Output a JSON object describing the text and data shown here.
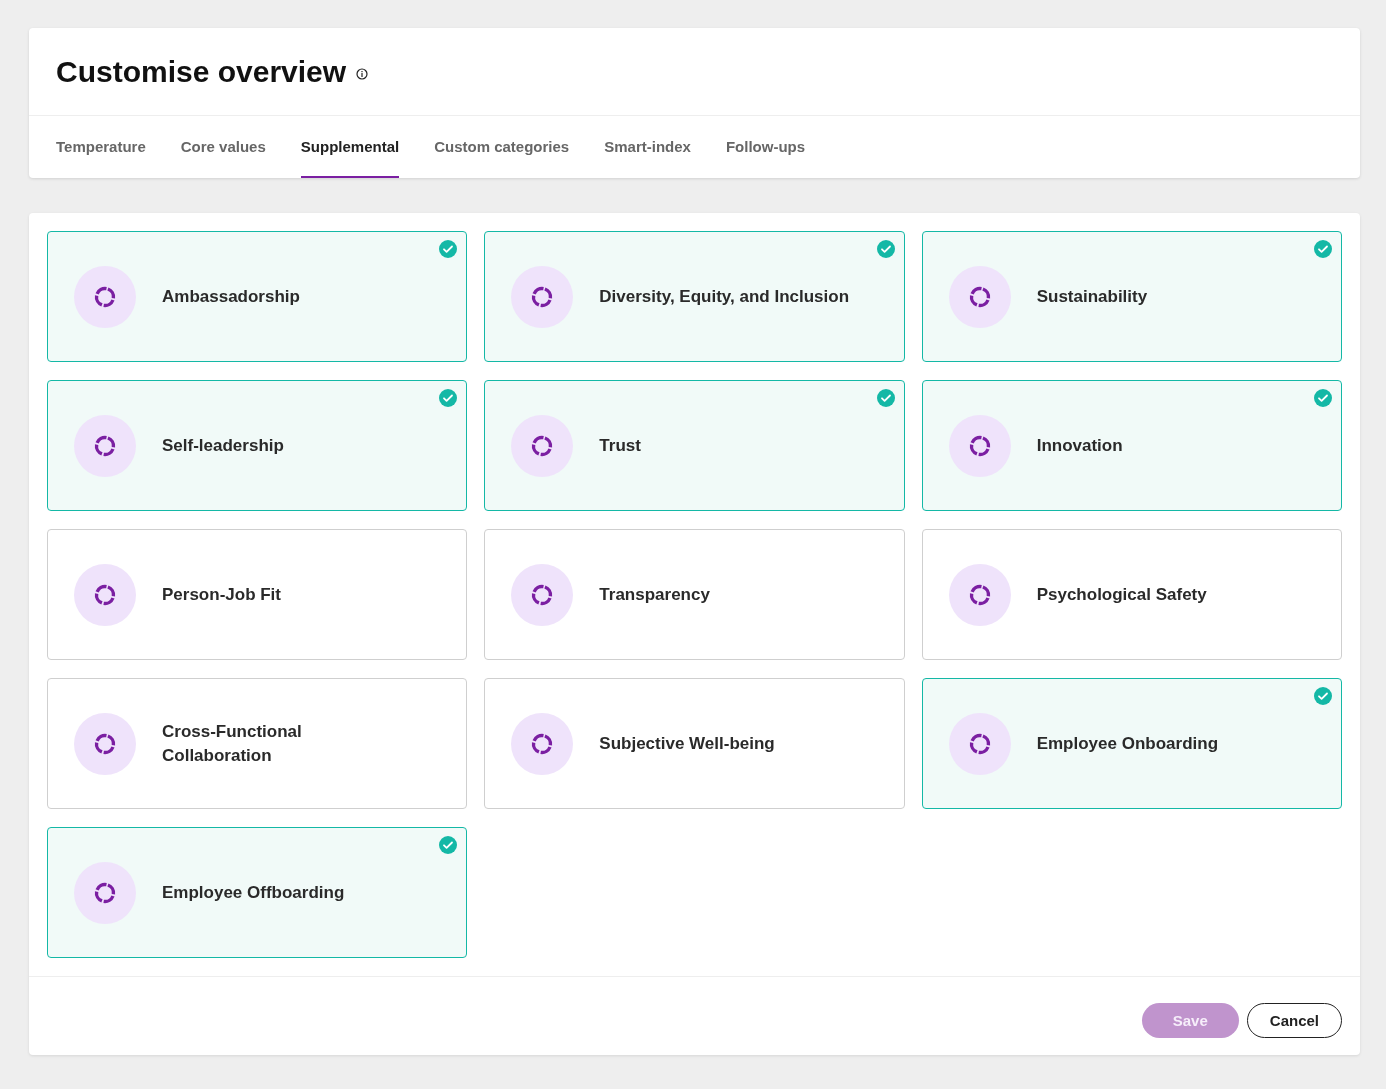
{
  "header": {
    "title": "Customise overview"
  },
  "tabs": [
    {
      "label": "Temperature",
      "selected": false
    },
    {
      "label": "Core values",
      "selected": false
    },
    {
      "label": "Supplemental",
      "selected": true
    },
    {
      "label": "Custom categories",
      "selected": false
    },
    {
      "label": "Smart-index",
      "selected": false
    },
    {
      "label": "Follow-ups",
      "selected": false
    }
  ],
  "categories": [
    {
      "label": "Ambassadorship",
      "selected": true
    },
    {
      "label": "Diversity, Equity, and Inclusion",
      "selected": true
    },
    {
      "label": "Sustainability",
      "selected": true
    },
    {
      "label": "Self-leadership",
      "selected": true
    },
    {
      "label": "Trust",
      "selected": true
    },
    {
      "label": "Innovation",
      "selected": true
    },
    {
      "label": "Person-Job Fit",
      "selected": false
    },
    {
      "label": "Transparency",
      "selected": false
    },
    {
      "label": "Psychological Safety",
      "selected": false
    },
    {
      "label": "Cross-Functional Collaboration",
      "selected": false
    },
    {
      "label": "Subjective Well-being",
      "selected": false
    },
    {
      "label": "Employee Onboarding",
      "selected": true
    },
    {
      "label": "Employee Offboarding",
      "selected": true
    }
  ],
  "buttons": [
    {
      "label": "Save",
      "kind": "primary",
      "disabled": true
    },
    {
      "label": "Cancel",
      "kind": "secondary",
      "disabled": false
    }
  ]
}
